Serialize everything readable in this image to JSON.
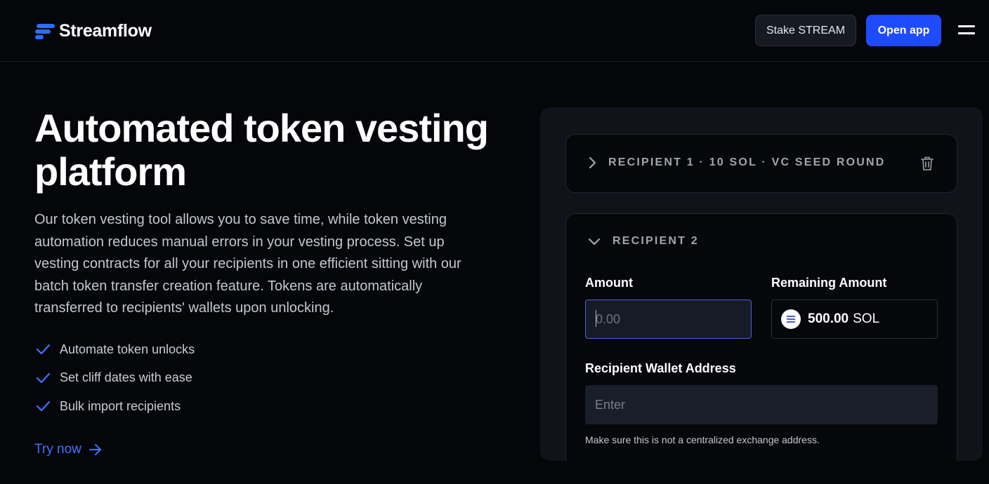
{
  "header": {
    "logo_text": "Streamflow",
    "stake_label": "Stake STREAM",
    "open_app_label": "Open app"
  },
  "hero": {
    "title": "Automated token vesting platform",
    "description": "Our token vesting tool allows you to save time, while token vesting automation reduces manual errors in your vesting process. Set up vesting contracts for all your recipients in one efficient sitting with our batch token transfer creation feature. Tokens are automatically transferred to recipients' wallets upon unlocking.",
    "features": [
      "Automate token unlocks",
      "Set cliff dates with ease",
      "Bulk import recipients"
    ],
    "cta_label": "Try now"
  },
  "form": {
    "recipient1_label": "Recipient 1 · 10 SOL · VC Seed Round",
    "recipient2_label": "Recipient 2",
    "amount_label": "Amount",
    "amount_placeholder": "0.00",
    "remaining_label": "Remaining Amount",
    "remaining_value": "500.00",
    "remaining_unit": "SOL",
    "wallet_label": "Recipient Wallet Address",
    "wallet_placeholder": "Enter",
    "wallet_hint": "Make sure this is not a centralized exchange address."
  },
  "colors": {
    "accent": "#1f4bff",
    "link": "#3f73ff",
    "background": "#05060a"
  }
}
